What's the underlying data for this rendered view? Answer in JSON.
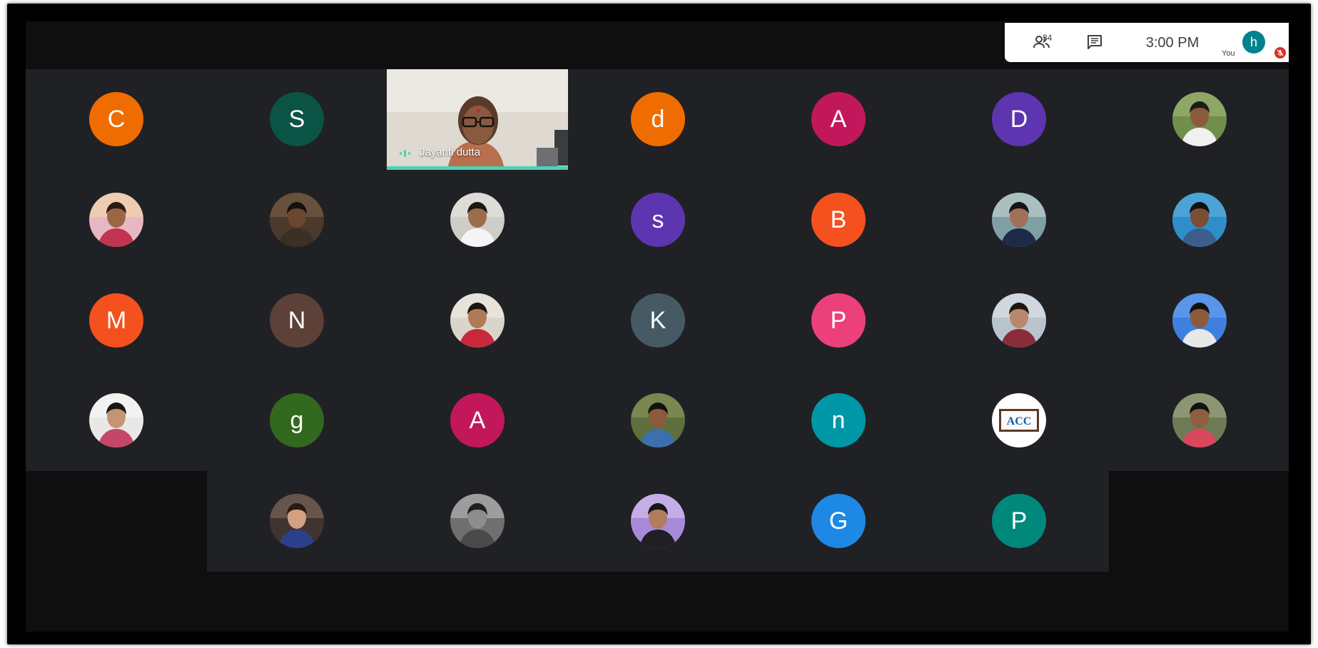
{
  "topbar": {
    "people_count": "34",
    "clock": "3:00 PM",
    "you_label": "You",
    "you_initial": "h",
    "you_color": "#00838f"
  },
  "video": {
    "name": "Jayanti dutta",
    "speaking_color": "#4dd0b5"
  },
  "participants": [
    {
      "row": 0,
      "col": 0,
      "initial": "C",
      "color": "#ef6c00"
    },
    {
      "row": 0,
      "col": 1,
      "initial": "S",
      "color": "#0b5345"
    },
    {
      "row": 0,
      "col": 3,
      "initial": "d",
      "color": "#ef6c00"
    },
    {
      "row": 0,
      "col": 4,
      "initial": "A",
      "color": "#c2185b"
    },
    {
      "row": 0,
      "col": 5,
      "initial": "D",
      "color": "#5e35b1"
    },
    {
      "row": 0,
      "col": 6,
      "photo": "garden-standing"
    },
    {
      "row": 1,
      "col": 0,
      "photo": "pink-room"
    },
    {
      "row": 1,
      "col": 1,
      "photo": "man-closeup"
    },
    {
      "row": 1,
      "col": 2,
      "photo": "man-shirt"
    },
    {
      "row": 1,
      "col": 3,
      "initial": "s",
      "color": "#5e35b1"
    },
    {
      "row": 1,
      "col": 4,
      "initial": "B",
      "color": "#f4511e"
    },
    {
      "row": 1,
      "col": 5,
      "photo": "man-suit"
    },
    {
      "row": 1,
      "col": 6,
      "photo": "man-blue-bg"
    },
    {
      "row": 2,
      "col": 0,
      "initial": "M",
      "color": "#f4511e"
    },
    {
      "row": 2,
      "col": 1,
      "initial": "N",
      "color": "#5d4037"
    },
    {
      "row": 2,
      "col": 2,
      "photo": "woman-red-saree"
    },
    {
      "row": 2,
      "col": 3,
      "initial": "K",
      "color": "#455a64"
    },
    {
      "row": 2,
      "col": 4,
      "initial": "P",
      "color": "#ec407a"
    },
    {
      "row": 2,
      "col": 5,
      "photo": "woman-portrait"
    },
    {
      "row": 2,
      "col": 6,
      "photo": "man-passport"
    },
    {
      "row": 3,
      "col": 0,
      "photo": "woman-glasses"
    },
    {
      "row": 3,
      "col": 1,
      "initial": "g",
      "color": "#33691e"
    },
    {
      "row": 3,
      "col": 2,
      "initial": "A",
      "color": "#c2185b"
    },
    {
      "row": 3,
      "col": 3,
      "photo": "man-outdoor"
    },
    {
      "row": 3,
      "col": 4,
      "initial": "n",
      "color": "#0097a7"
    },
    {
      "row": 3,
      "col": 5,
      "photo": "acc-logo",
      "logo_text": "ACC"
    },
    {
      "row": 3,
      "col": 6,
      "photo": "man-red-shirt"
    },
    {
      "row": 4,
      "col": 1,
      "photo": "woman-selfie"
    },
    {
      "row": 4,
      "col": 2,
      "photo": "bw-man"
    },
    {
      "row": 4,
      "col": 3,
      "photo": "man-purple-bg"
    },
    {
      "row": 4,
      "col": 4,
      "initial": "G",
      "color": "#1e88e5"
    },
    {
      "row": 4,
      "col": 5,
      "initial": "P",
      "color": "#00897b"
    }
  ]
}
